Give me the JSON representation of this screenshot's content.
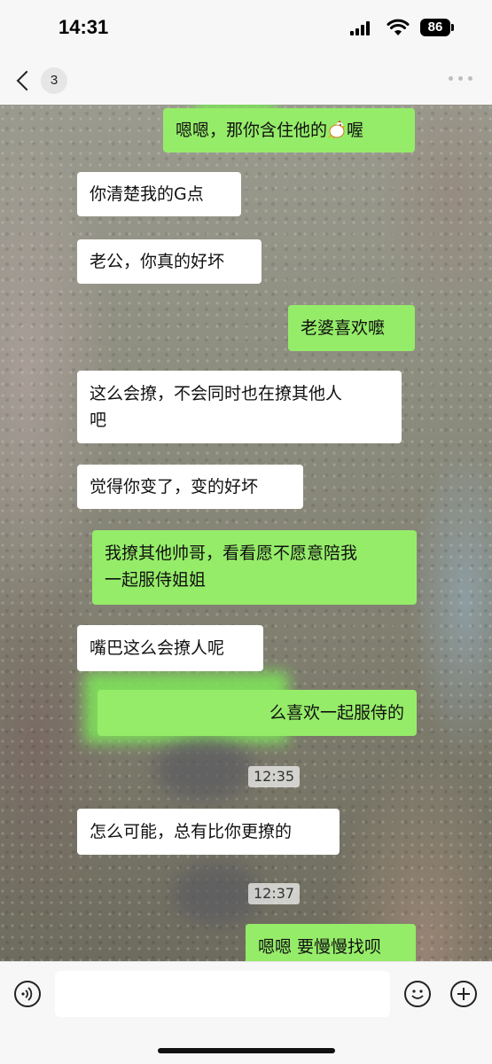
{
  "status_bar": {
    "time": "14:31",
    "battery": "86"
  },
  "header": {
    "unread_count": "3"
  },
  "messages": [
    {
      "side": "out",
      "text": "嗯嗯，那你含住他的",
      "suffix": "喔",
      "emoji": "hen-icon"
    },
    {
      "side": "in",
      "text": "你清楚我的G点"
    },
    {
      "side": "in",
      "text": "老公，你真的好坏"
    },
    {
      "side": "out",
      "text": "老婆喜欢嚒"
    },
    {
      "side": "in",
      "lines": [
        "这么会撩，不会同时也在撩其他人",
        "吧"
      ]
    },
    {
      "side": "in",
      "text": "觉得你变了，变的好坏"
    },
    {
      "side": "out",
      "lines": [
        "我撩其他帅哥，看看愿不愿意陪我",
        "一起服侍姐姐"
      ]
    },
    {
      "side": "in",
      "text": "嘴巴这么会撩人呢"
    },
    {
      "side": "out",
      "text": "么喜欢一起服侍的"
    },
    {
      "side": "in",
      "text": "怎么可能，总有比你更撩的"
    },
    {
      "side": "out",
      "text": "嗯嗯 要慢慢找呗"
    }
  ],
  "timestamps": [
    "12:35",
    "12:37"
  ],
  "input": {
    "placeholder": ""
  },
  "colors": {
    "outgoing_bubble": "#95ec69",
    "incoming_bubble": "#ffffff",
    "bar_background": "#f7f7f7"
  }
}
